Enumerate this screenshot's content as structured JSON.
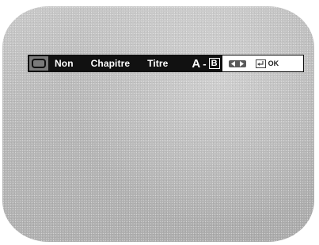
{
  "osd": {
    "repeat_icon": "repeat-loop-icon",
    "options": [
      "Non",
      "Chapitre",
      "Titre"
    ],
    "ab": {
      "a": "A",
      "dash": "-",
      "b": "B"
    },
    "hints": {
      "nav_icon": "left-right-arrows-icon",
      "enter_icon": "enter-key-icon",
      "ok": "OK"
    }
  },
  "colors": {
    "bar": "#111111",
    "hint_panel": "#ffffff",
    "screen": "#b8b8b8"
  }
}
